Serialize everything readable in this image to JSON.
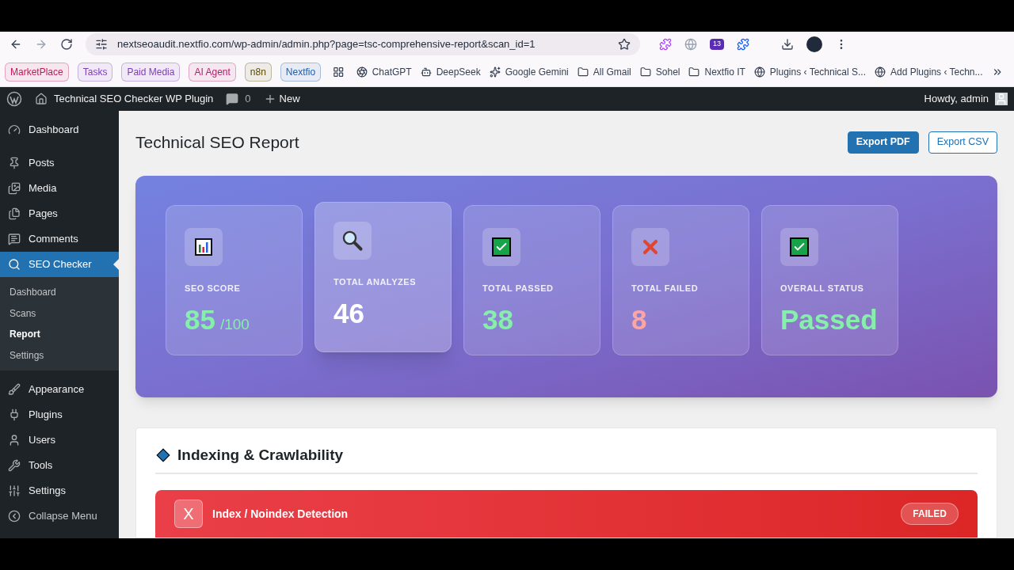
{
  "browser": {
    "url": "nextseoaudit.nextfio.com/wp-admin/admin.php?page=tsc-comprehensive-report&scan_id=1",
    "extension_badge": "13",
    "bookmarks": [
      {
        "label": "MarketPlace",
        "kind": "chip",
        "color": "#c2185b"
      },
      {
        "label": "Tasks",
        "kind": "chip",
        "color": "#7b3fb5"
      },
      {
        "label": "Paid Media",
        "kind": "chip",
        "color": "#7b3fb5"
      },
      {
        "label": "AI Agent",
        "kind": "chip",
        "color": "#b0206a"
      },
      {
        "label": "n8n",
        "kind": "chip",
        "color": "#5a4a00"
      },
      {
        "label": "Nextfio",
        "kind": "chip",
        "color": "#1f5fa8"
      },
      {
        "kind": "apps"
      },
      {
        "label": "ChatGPT",
        "kind": "ai"
      },
      {
        "label": "DeepSeek",
        "kind": "ai"
      },
      {
        "label": "Google Gemini",
        "kind": "ai"
      },
      {
        "label": "All Gmail",
        "kind": "folder"
      },
      {
        "label": "Sohel",
        "kind": "folder"
      },
      {
        "label": "Nextfio IT",
        "kind": "folder"
      },
      {
        "label": "Plugins ‹ Technical S...",
        "kind": "globe"
      },
      {
        "label": "Add Plugins ‹ Techn...",
        "kind": "globe"
      }
    ]
  },
  "admin_bar": {
    "site": "Technical SEO Checker WP Plugin",
    "comments": "0",
    "new": "New",
    "greeting": "Howdy, admin"
  },
  "sidebar": {
    "items": [
      {
        "label": "Dashboard",
        "selected": false
      },
      {
        "label": "Posts",
        "selected": false
      },
      {
        "label": "Media",
        "selected": false
      },
      {
        "label": "Pages",
        "selected": false
      },
      {
        "label": "Comments",
        "selected": false
      },
      {
        "label": "SEO Checker",
        "selected": true,
        "children": [
          {
            "label": "Dashboard",
            "selected": false
          },
          {
            "label": "Scans",
            "selected": false
          },
          {
            "label": "Report",
            "selected": true
          },
          {
            "label": "Settings",
            "selected": false
          }
        ]
      },
      {
        "label": "Appearance",
        "selected": false
      },
      {
        "label": "Plugins",
        "selected": false
      },
      {
        "label": "Users",
        "selected": false
      },
      {
        "label": "Tools",
        "selected": false
      },
      {
        "label": "Settings",
        "selected": false
      },
      {
        "label": "Collapse Menu",
        "selected": false
      }
    ]
  },
  "page": {
    "title": "Technical SEO Report",
    "buttons": [
      {
        "label": "Export PDF",
        "kind": "primary"
      },
      {
        "label": "Export CSV",
        "kind": "secondary"
      }
    ]
  },
  "stats": [
    {
      "label": "SEO SCORE",
      "value": "85",
      "suffix": "/100",
      "color": "#86efac",
      "selected": false
    },
    {
      "label": "TOTAL ANALYZES",
      "value": "46",
      "color": "#ffffff",
      "selected": true
    },
    {
      "label": "TOTAL PASSED",
      "value": "38",
      "color": "#86efac",
      "selected": false
    },
    {
      "label": "TOTAL FAILED",
      "value": "8",
      "color": "#fca5a5",
      "selected": false
    },
    {
      "label": "OVERALL STATUS",
      "value": "Passed",
      "color": "#86efac",
      "selected": false
    }
  ],
  "section": {
    "title": "Indexing & Crawlability",
    "checks": [
      {
        "mark": "X",
        "title": "Index / Noindex Detection",
        "status": "FAILED",
        "passed": false
      }
    ]
  }
}
